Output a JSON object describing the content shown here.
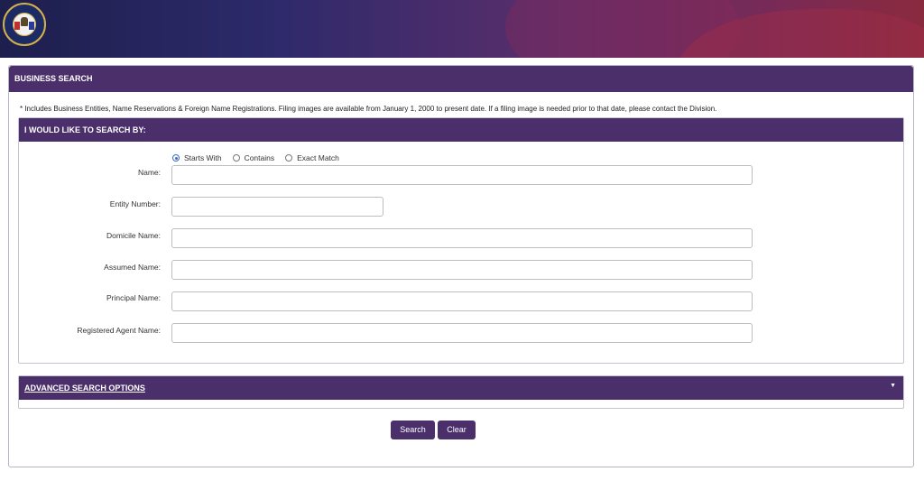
{
  "banner": {
    "seal_text": "THE GREAT SEAL OF THE STATE OF UTAH 1896"
  },
  "business_search": {
    "title": "BUSINESS SEARCH",
    "note": "* Includes Business Entities, Name Reservations & Foreign Name Registrations. Filing images are available from January 1, 2000 to present date. If a filing image is needed prior to that date, please contact the Division.",
    "search_by": {
      "title": "I WOULD LIKE TO SEARCH BY:",
      "match_options": [
        {
          "label": "Starts With",
          "selected": true
        },
        {
          "label": "Contains",
          "selected": false
        },
        {
          "label": "Exact Match",
          "selected": false
        }
      ],
      "fields": {
        "name": {
          "label": "Name:",
          "value": ""
        },
        "entity_number": {
          "label": "Entity Number:",
          "value": ""
        },
        "domicile_name": {
          "label": "Domicile Name:",
          "value": ""
        },
        "assumed_name": {
          "label": "Assumed Name:",
          "value": ""
        },
        "principal_name": {
          "label": "Principal Name:",
          "value": ""
        },
        "registered_agent_name": {
          "label": "Registered Agent Name:",
          "value": ""
        }
      }
    },
    "advanced": {
      "title": "ADVANCED SEARCH OPTIONS",
      "caret_icon": "caret-down-icon"
    },
    "buttons": {
      "search": "Search",
      "clear": "Clear"
    }
  },
  "colors": {
    "header_purple": "#4a2f6a",
    "radio_selected": "#3a6cc8"
  }
}
